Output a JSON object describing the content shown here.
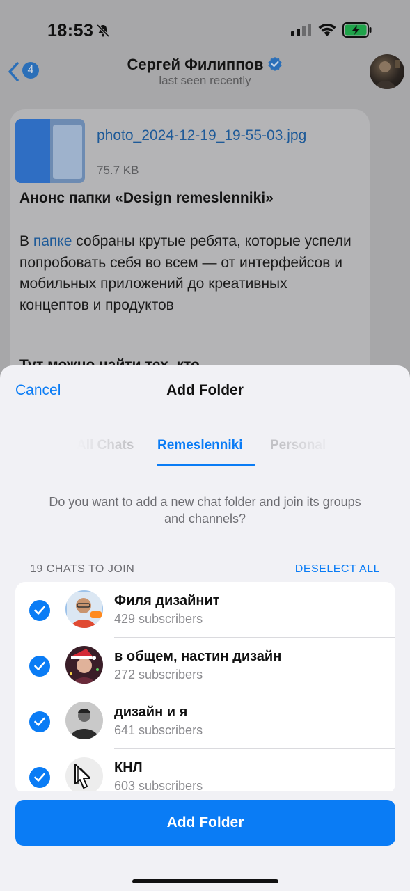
{
  "status_bar": {
    "time": "18:53"
  },
  "nav": {
    "back_count": "4",
    "title": "Сергей Филиппов",
    "subtitle": "last seen recently"
  },
  "message": {
    "file_name": "photo_2024-12-19_19-55-03.jpg",
    "file_size": "75.7 KB",
    "title": "Анонс папки «Design remeslenniki»",
    "body_prefix": "В ",
    "body_link": "папке",
    "body_suffix": " собраны крутые ребята, которые успели попробовать себя во всем — от интерфейсов и мобильных приложений до креативных концептов и продуктов",
    "cut_line": "Тут можно найти тех, кто"
  },
  "sheet": {
    "cancel_label": "Cancel",
    "title": "Add Folder",
    "tabs": [
      {
        "label": "All Chats",
        "active": false
      },
      {
        "label": "Remeslenniki",
        "active": true
      },
      {
        "label": "Personal",
        "active": false
      }
    ],
    "description": "Do you want to add a new chat folder and join its groups and channels?",
    "section_label": "19 CHATS TO JOIN",
    "deselect_label": "DESELECT ALL",
    "chats": [
      {
        "name": "Филя дизайнит",
        "subscribers": "429 subscribers",
        "checked": true
      },
      {
        "name": "в общем, настин дизайн",
        "subscribers": "272 subscribers",
        "checked": true
      },
      {
        "name": "дизайн и я",
        "subscribers": "641 subscribers",
        "checked": true
      },
      {
        "name": "КНЛ",
        "subscribers": "603 subscribers",
        "checked": true
      }
    ],
    "add_button_label": "Add Folder"
  },
  "colors": {
    "accent": "#0a7cf5",
    "sheet_bg": "#f1f1f5",
    "secondary_text": "#6d6d72"
  }
}
